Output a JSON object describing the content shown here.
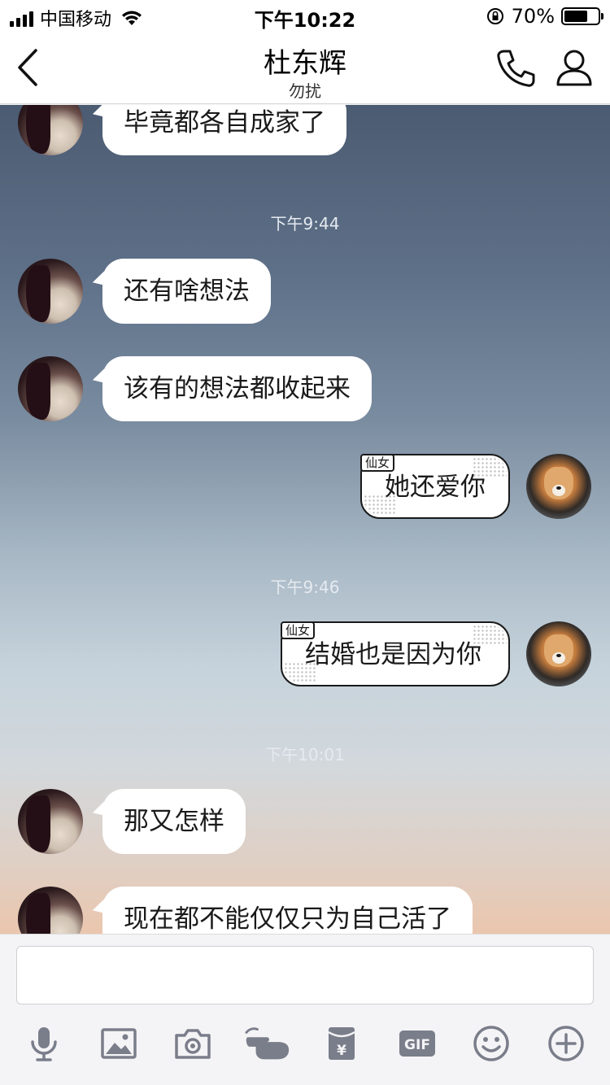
{
  "status_bar": {
    "carrier": "中国移动",
    "time": "下午10:22",
    "battery": "70%",
    "battery_level": 0.7
  },
  "header": {
    "title": "杜东辉",
    "subtitle": "勿扰"
  },
  "messages": [
    {
      "side": "left",
      "text": "毕竟都各自成家了"
    },
    {
      "type": "time",
      "text": "下午9:44"
    },
    {
      "side": "left",
      "text": "还有啥想法"
    },
    {
      "side": "left",
      "text": "该有的想法都收起来"
    },
    {
      "side": "right",
      "tag": "仙女",
      "text": "她还爱你"
    },
    {
      "type": "time",
      "text": "下午9:46"
    },
    {
      "side": "right",
      "tag": "仙女",
      "text": "结婚也是因为你"
    },
    {
      "type": "time",
      "text": "下午10:01"
    },
    {
      "side": "left",
      "text": "那又怎样"
    },
    {
      "side": "left",
      "text": "现在都不能仅仅只为自己活了"
    }
  ],
  "input": {
    "value": "",
    "placeholder": ""
  },
  "toolbar_icons": [
    "microphone-icon",
    "image-icon",
    "camera-icon",
    "poke-hand-icon",
    "red-packet-icon",
    "gif-icon",
    "emoji-icon",
    "plus-icon"
  ],
  "toolbar": {
    "gif_label": "GIF",
    "red_packet_label": "¥"
  },
  "colors": {
    "icon": "#7a7d8a",
    "bubble_left": "#ffffff",
    "bubble_right_border": "#1a1a1a"
  }
}
